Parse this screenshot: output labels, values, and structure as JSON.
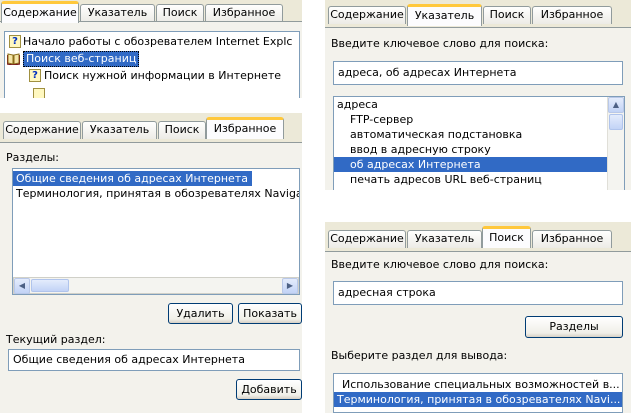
{
  "contents_panel": {
    "tabs": [
      "Содержание",
      "Указатель",
      "Поиск",
      "Избранное"
    ],
    "active_tab": "Содержание",
    "tree": [
      {
        "label": "Начало работы с обозревателем Internet Explc",
        "icon": "help-page-icon"
      },
      {
        "label": "Поиск веб-страниц",
        "icon": "open-book-icon",
        "selected": true
      },
      {
        "label": "Поиск нужной информации в Интернете",
        "icon": "help-page-icon"
      }
    ]
  },
  "index_panel": {
    "tabs": [
      "Содержание",
      "Указатель",
      "Поиск",
      "Избранное"
    ],
    "active_tab": "Указатель",
    "keyword_label": "Введите ключевое слово для поиска:",
    "keyword_value": "адреса, об адресах Интернета",
    "items": [
      "адреса",
      "FTP-сервер",
      "автоматическая подстановка",
      "ввод в адресную строку",
      "об адресах Интернета",
      "печать адресов URL веб-страниц"
    ],
    "selected_index": 4
  },
  "favorites_panel": {
    "tabs": [
      "Содержание",
      "Указатель",
      "Поиск",
      "Избранное"
    ],
    "active_tab": "Избранное",
    "topics_label": "Разделы:",
    "topics": [
      "Общие сведения об адресах Интернета",
      "Терминология, принятая в обозревателях Navigat"
    ],
    "selected_index": 0,
    "delete_label": "Удалить",
    "show_label": "Показать",
    "current_topic_label": "Текущий раздел:",
    "current_topic_value": "Общие сведения об адресах Интернета",
    "add_label": "Добавить"
  },
  "search_panel": {
    "tabs": [
      "Содержание",
      "Указатель",
      "Поиск",
      "Избранное"
    ],
    "active_tab": "Поиск",
    "keyword_label": "Введите ключевое слово для поиска:",
    "keyword_value": "адресная строка",
    "topics_button": "Разделы",
    "select_label": "Выберите раздел для вывода:",
    "results": [
      "Использование специальных возможностей в...",
      "Терминология, принятая в обозревателях Navi..."
    ],
    "selected_index": 1
  },
  "colors": {
    "selection": "#316ac5",
    "tab_accent": "#ffc83c",
    "panel_bg": "#ece9d8",
    "border": "#7f9db9"
  }
}
